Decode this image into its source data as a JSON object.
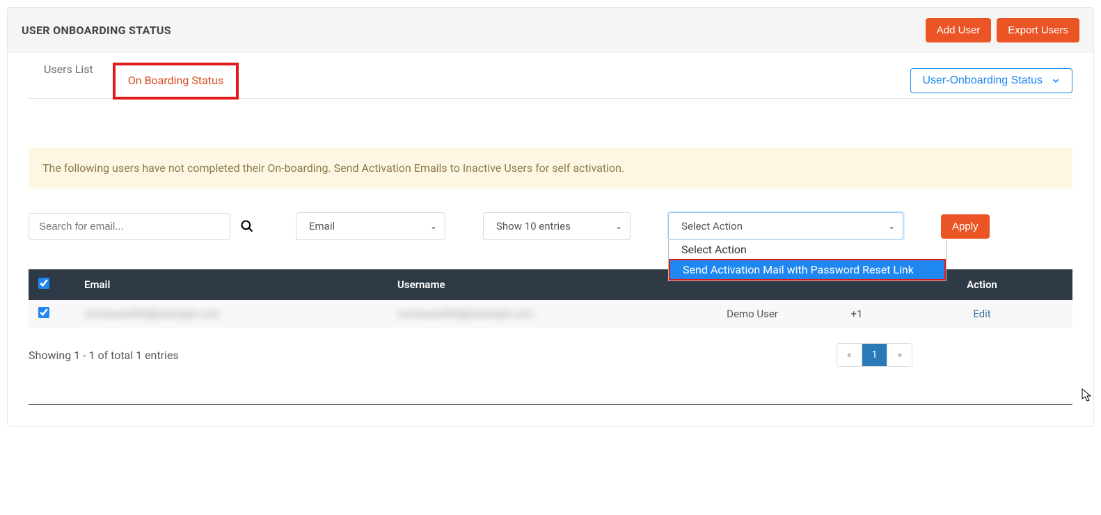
{
  "header": {
    "title": "USER ONBOARDING STATUS",
    "add_user": "Add User",
    "export_users": "Export Users"
  },
  "tabs": {
    "users_list": "Users List",
    "onboarding_status": "On Boarding Status"
  },
  "status_dropdown": {
    "label": "User-Onboarding Status"
  },
  "banner": {
    "text": "The following users have not completed their On-boarding. Send Activation Emails to Inactive Users for self activation."
  },
  "controls": {
    "search_placeholder": "Search for email...",
    "filter_field": "Email",
    "entries_label": "Show 10 entries",
    "action_selected": "Select Action",
    "apply": "Apply"
  },
  "action_dropdown": {
    "option1": "Select Action",
    "option2": "Send Activation Mail with Password Reset Link"
  },
  "table": {
    "headers": {
      "email": "Email",
      "username": "Username",
      "action": "Action"
    },
    "rows": [
      {
        "email": "someuser000@example.com",
        "username": "someuser000@example.com",
        "extra1": "Demo User",
        "extra2": "+1",
        "action_link": "Edit"
      }
    ]
  },
  "footer": {
    "showing": "Showing 1 - 1 of total 1 entries",
    "page_prev": "«",
    "page_current": "1",
    "page_next": "»"
  }
}
